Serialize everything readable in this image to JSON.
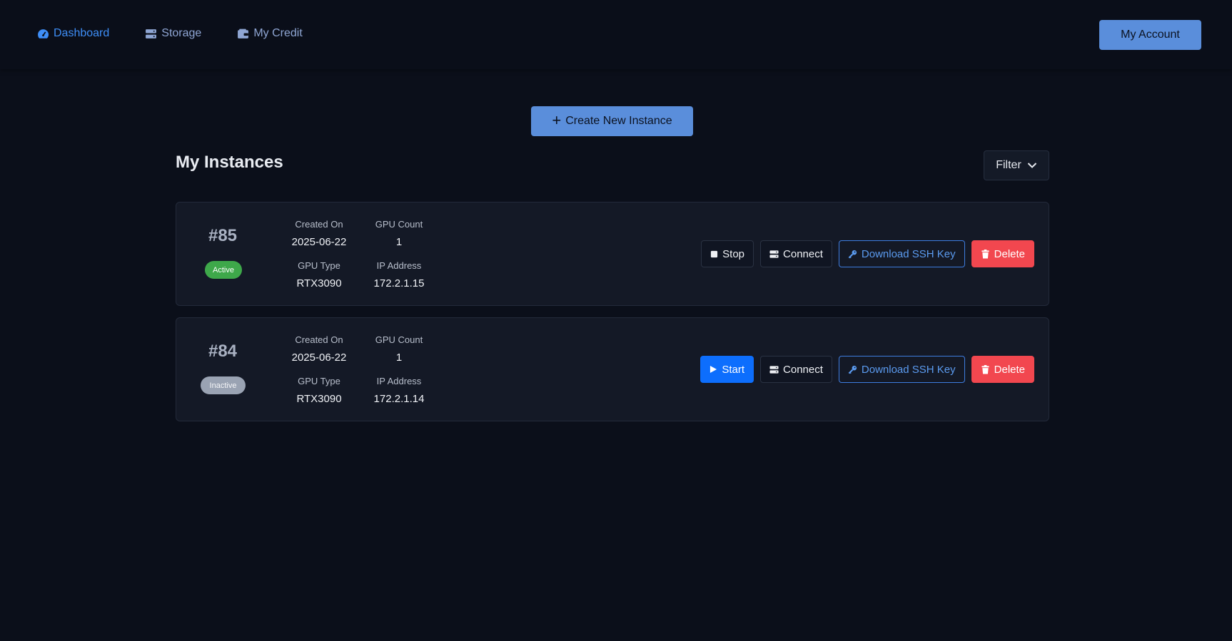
{
  "nav": {
    "items": [
      {
        "label": "Dashboard",
        "icon": "gauge-icon"
      },
      {
        "label": "Storage",
        "icon": "storage-icon"
      },
      {
        "label": "My Credit",
        "icon": "wallet-icon"
      }
    ],
    "account_label": "My Account"
  },
  "main": {
    "create_label": "Create New Instance",
    "title": "My Instances",
    "filter_label": "Filter"
  },
  "labels": {
    "created_on": "Created On",
    "gpu_count": "GPU Count",
    "gpu_type": "GPU Type",
    "ip_address": "IP Address"
  },
  "instances": [
    {
      "id": "#85",
      "status": "Active",
      "created_on": "2025-06-22",
      "gpu_count": "1",
      "gpu_type": "RTX3090",
      "ip_address": "172.2.1.15",
      "toggle_label": "Stop",
      "connect_label": "Connect",
      "ssh_label": "Download SSH Key",
      "delete_label": "Delete"
    },
    {
      "id": "#84",
      "status": "Inactive",
      "created_on": "2025-06-22",
      "gpu_count": "1",
      "gpu_type": "RTX3090",
      "ip_address": "172.2.1.14",
      "toggle_label": "Start",
      "connect_label": "Connect",
      "ssh_label": "Download SSH Key",
      "delete_label": "Delete"
    }
  ],
  "colors": {
    "background": "#0b0f1a",
    "accent": "#5a8edb",
    "active_nav": "#3e8ef7",
    "success": "#3ea84a",
    "danger": "#f2474f",
    "primary": "#0d6efd"
  }
}
